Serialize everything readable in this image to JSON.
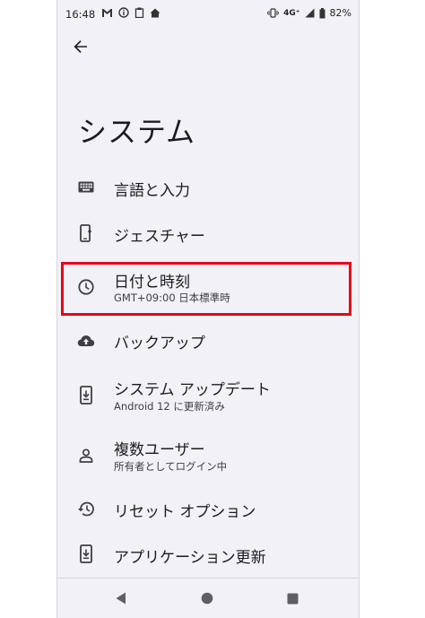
{
  "status_bar": {
    "time": "16:48",
    "network": "4G⁺",
    "battery_level": "82%",
    "left_icons": [
      "gmail-icon",
      "info-icon",
      "clipboard-icon",
      "home-icon"
    ],
    "right_icons": [
      "vibrate-icon",
      "signal-icon",
      "battery-icon"
    ]
  },
  "header": {
    "title": "システム"
  },
  "menu": {
    "items": [
      {
        "icon": "keyboard-icon",
        "title": "言語と入力",
        "subtitle": ""
      },
      {
        "icon": "gesture-phone-icon",
        "title": "ジェスチャー",
        "subtitle": ""
      },
      {
        "icon": "clock-icon",
        "title": "日付と時刻",
        "subtitle": "GMT+09:00 日本標準時",
        "highlighted": true
      },
      {
        "icon": "cloud-upload-icon",
        "title": "バックアップ",
        "subtitle": ""
      },
      {
        "icon": "system-update-icon",
        "title": "システム アップデート",
        "subtitle": "Android 12 に更新済み"
      },
      {
        "icon": "person-icon",
        "title": "複数ユーザー",
        "subtitle": "所有者としてログイン中"
      },
      {
        "icon": "history-icon",
        "title": "リセット オプション",
        "subtitle": ""
      },
      {
        "icon": "app-update-icon",
        "title": "アプリケーション更新",
        "subtitle": ""
      }
    ]
  },
  "highlight_color": "#e8001c",
  "nav_bar": {
    "buttons": [
      "back-nav-icon",
      "home-nav-icon",
      "recents-nav-icon"
    ]
  }
}
